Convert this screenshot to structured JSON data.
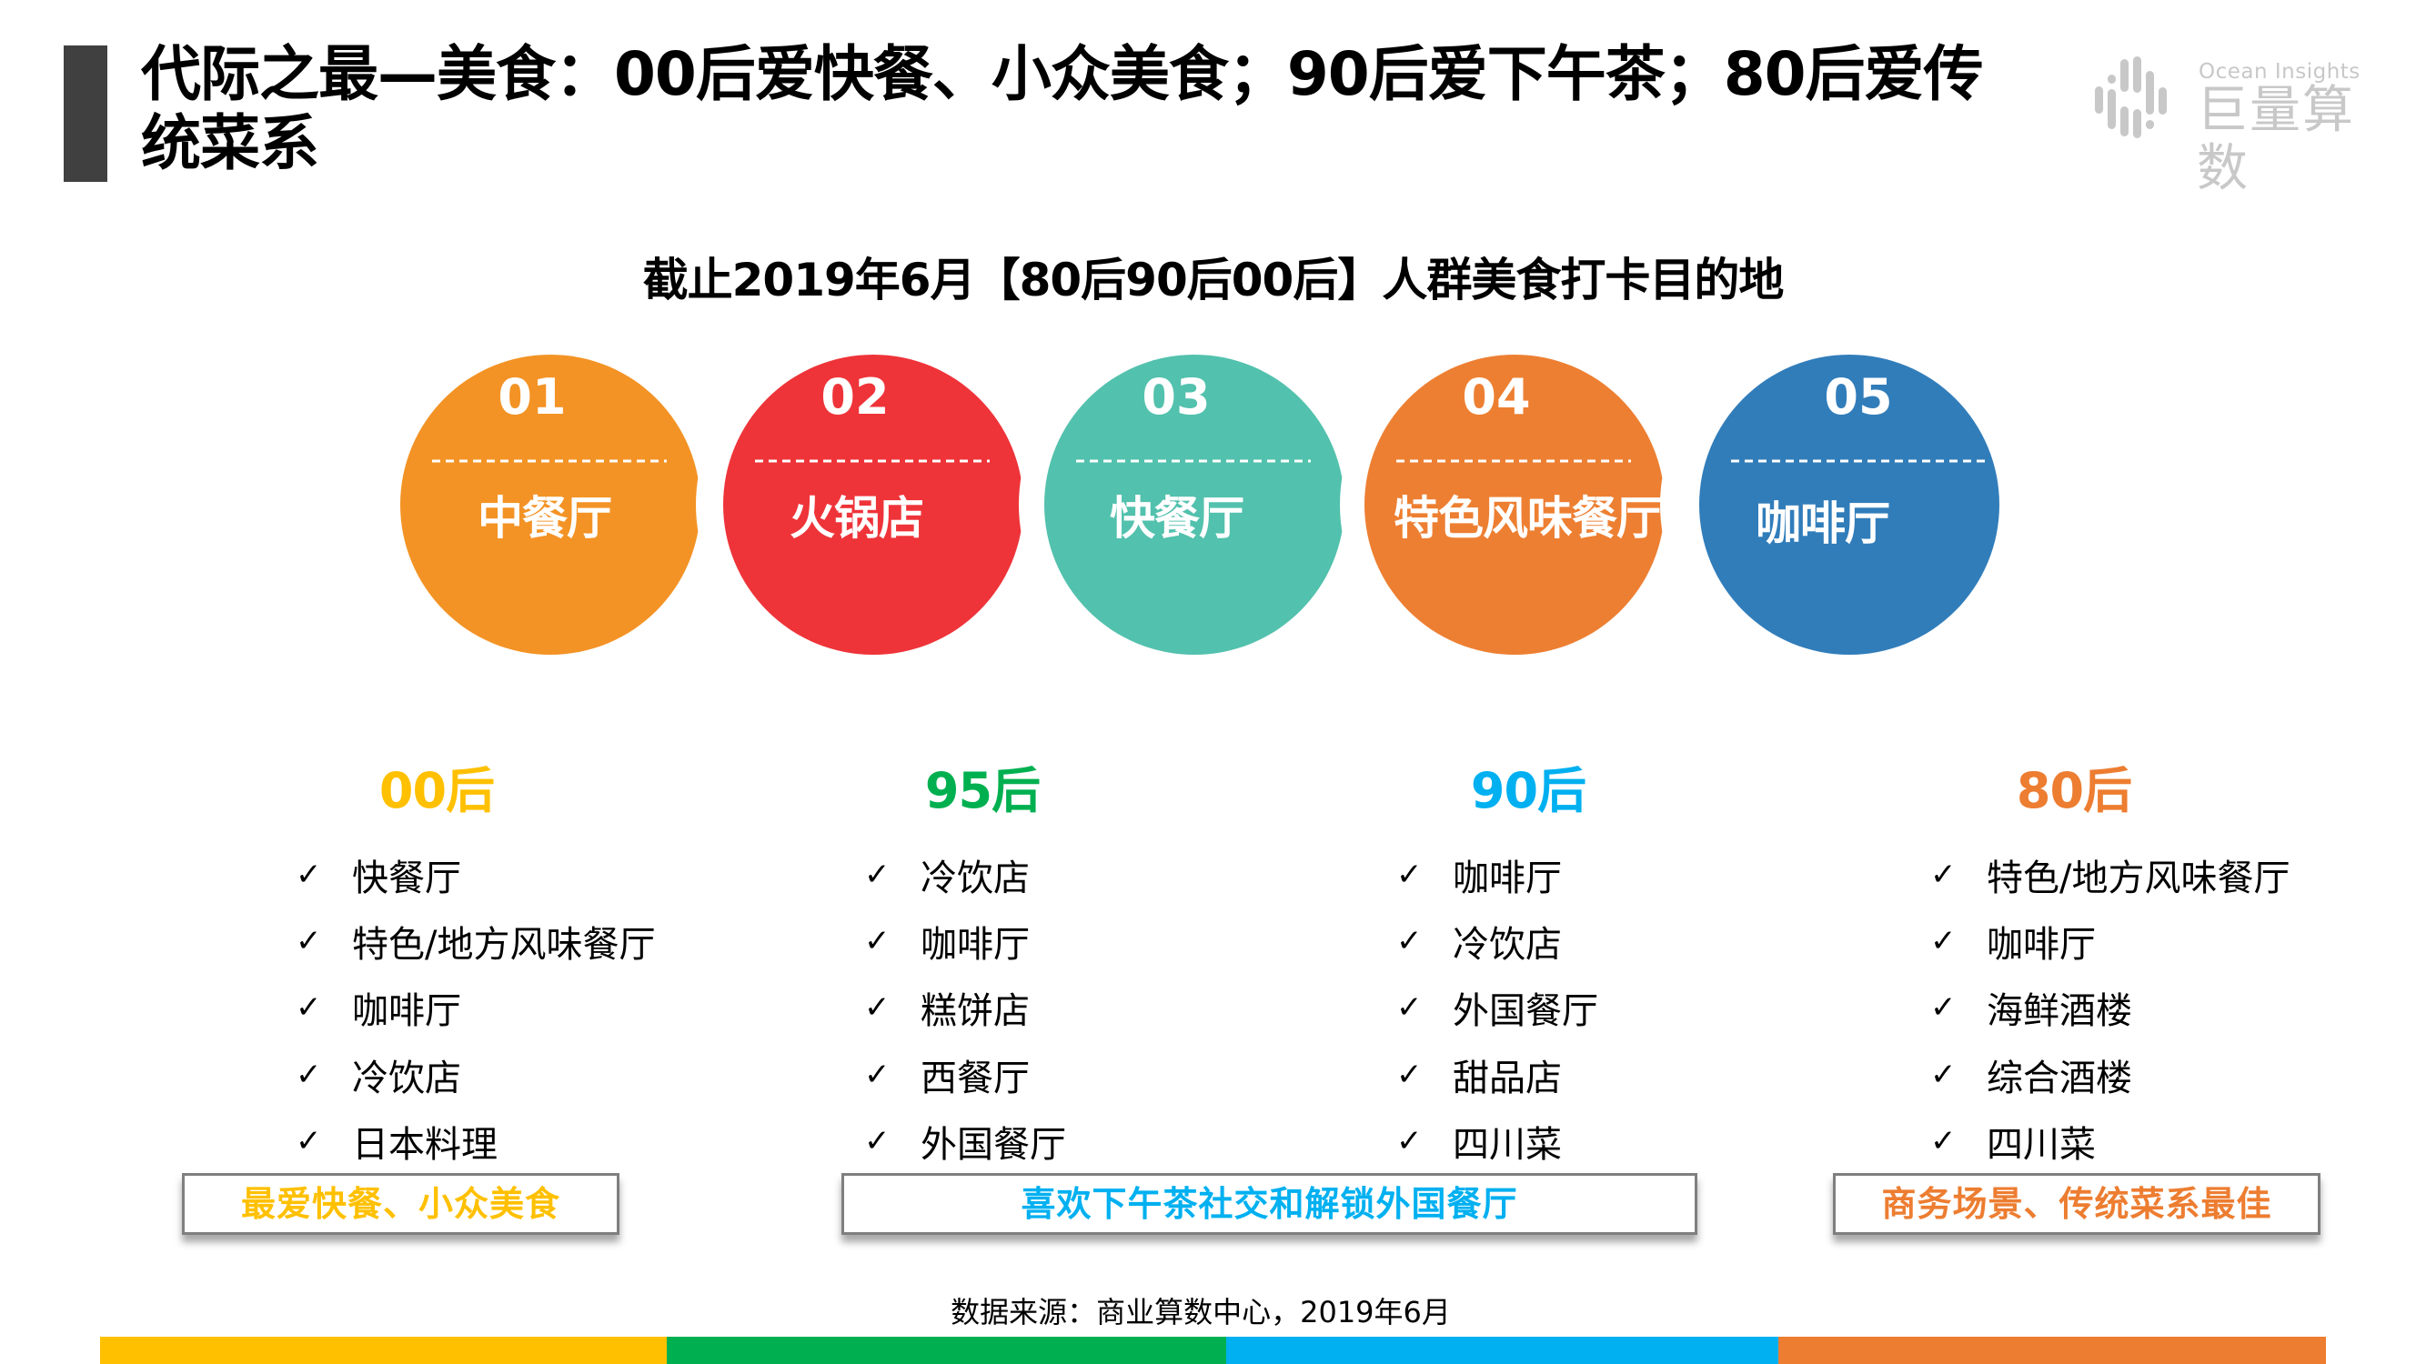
{
  "header": {
    "title": "代际之最—美食：00后爱快餐、小众美食；90后爱下午茶；80后爱传统菜系",
    "logo": {
      "icon": "ocean-insights-logo-icon",
      "english": "Ocean Insights",
      "chinese": "巨量算数"
    }
  },
  "subtitle": "截止2019年6月【80后90后00后】人群美食打卡目的地",
  "top_destinations": [
    {
      "rank": "01",
      "label": "中餐厅",
      "color": "#F39325"
    },
    {
      "rank": "02",
      "label": "火锅店",
      "color": "#EE3439"
    },
    {
      "rank": "03",
      "label": "快餐厅",
      "color": "#52C1AD"
    },
    {
      "rank": "04",
      "label": "特色风味餐厅",
      "color": "#ED7F32"
    },
    {
      "rank": "05",
      "label": "咖啡厅",
      "color": "#317DBA"
    }
  ],
  "generations": [
    {
      "name": "00后",
      "color": "#FFC000",
      "items": [
        "快餐厅",
        "特色/地方风味餐厅",
        "咖啡厅",
        "冷饮店",
        "日本料理"
      ],
      "summary": "最爱快餐、小众美食"
    },
    {
      "name": "95后",
      "color": "#00B050",
      "items": [
        "冷饮店",
        "咖啡厅",
        "糕饼店",
        "西餐厅",
        "外国餐厅"
      ],
      "summary": "喜欢下午茶社交和解锁外国餐厅"
    },
    {
      "name": "90后",
      "color": "#00B0F0",
      "items": [
        "咖啡厅",
        "冷饮店",
        "外国餐厅",
        "甜品店",
        "四川菜"
      ],
      "summary": null
    },
    {
      "name": "80后",
      "color": "#ED7D31",
      "items": [
        "特色/地方风味餐厅",
        "咖啡厅",
        "海鲜酒楼",
        "综合酒楼",
        "四川菜"
      ],
      "summary": "商务场景、传统菜系最佳"
    }
  ],
  "check_icon": "✓",
  "summary_colors": {
    "box1": "#FFC000",
    "box2": "#00B0F0",
    "box3": "#ED7D31"
  },
  "source": "数据来源：商业算数中心，2019年6月",
  "footer_colors": [
    "#FFC000",
    "#00B050",
    "#00B0F0",
    "#ED7D31"
  ]
}
